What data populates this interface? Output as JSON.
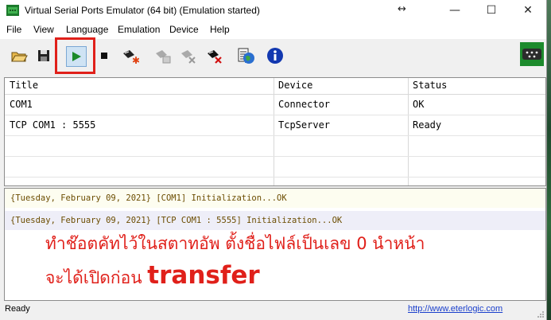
{
  "window": {
    "title": "Virtual Serial Ports Emulator (64 bit) (Emulation started)",
    "resize_glyph": "↔",
    "min_glyph": "—",
    "max_glyph": "☐",
    "close_glyph": "✕"
  },
  "menu": [
    "File",
    "View",
    "Language",
    "Emulation",
    "Device",
    "Help"
  ],
  "toolbar": {
    "icons": [
      "open-folder-icon",
      "save-icon",
      "play-icon",
      "stop-icon",
      "device-new-icon",
      "device-edit-icon",
      "device-disabled-icon",
      "device-delete-icon",
      "log-icon",
      "globe-icon",
      "info-icon",
      "serial-port-icon"
    ],
    "accent": "#e0201a"
  },
  "devices": {
    "columns": [
      "Title",
      "Device",
      "Status"
    ],
    "rows": [
      {
        "title": "COM1",
        "device": "Connector",
        "status": "OK"
      },
      {
        "title": "TCP COM1 : 5555",
        "device": "TcpServer",
        "status": "Ready"
      }
    ]
  },
  "log": [
    "{Tuesday, February 09, 2021} [COM1] Initialization...OK",
    "{Tuesday, February 09, 2021} [TCP COM1 : 5555] Initialization...OK"
  ],
  "annotation": {
    "line1": "ทำช๊อตคัทไว้ในสตาทอัพ ตั้งชื่อไฟล์เป็นเลข 0 นำหน้า",
    "line2_prefix": "จะได้เปิดก่อน ",
    "line2_emphasis": "transfer"
  },
  "status": {
    "text": "Ready",
    "link": "http://www.eterlogic.com"
  }
}
